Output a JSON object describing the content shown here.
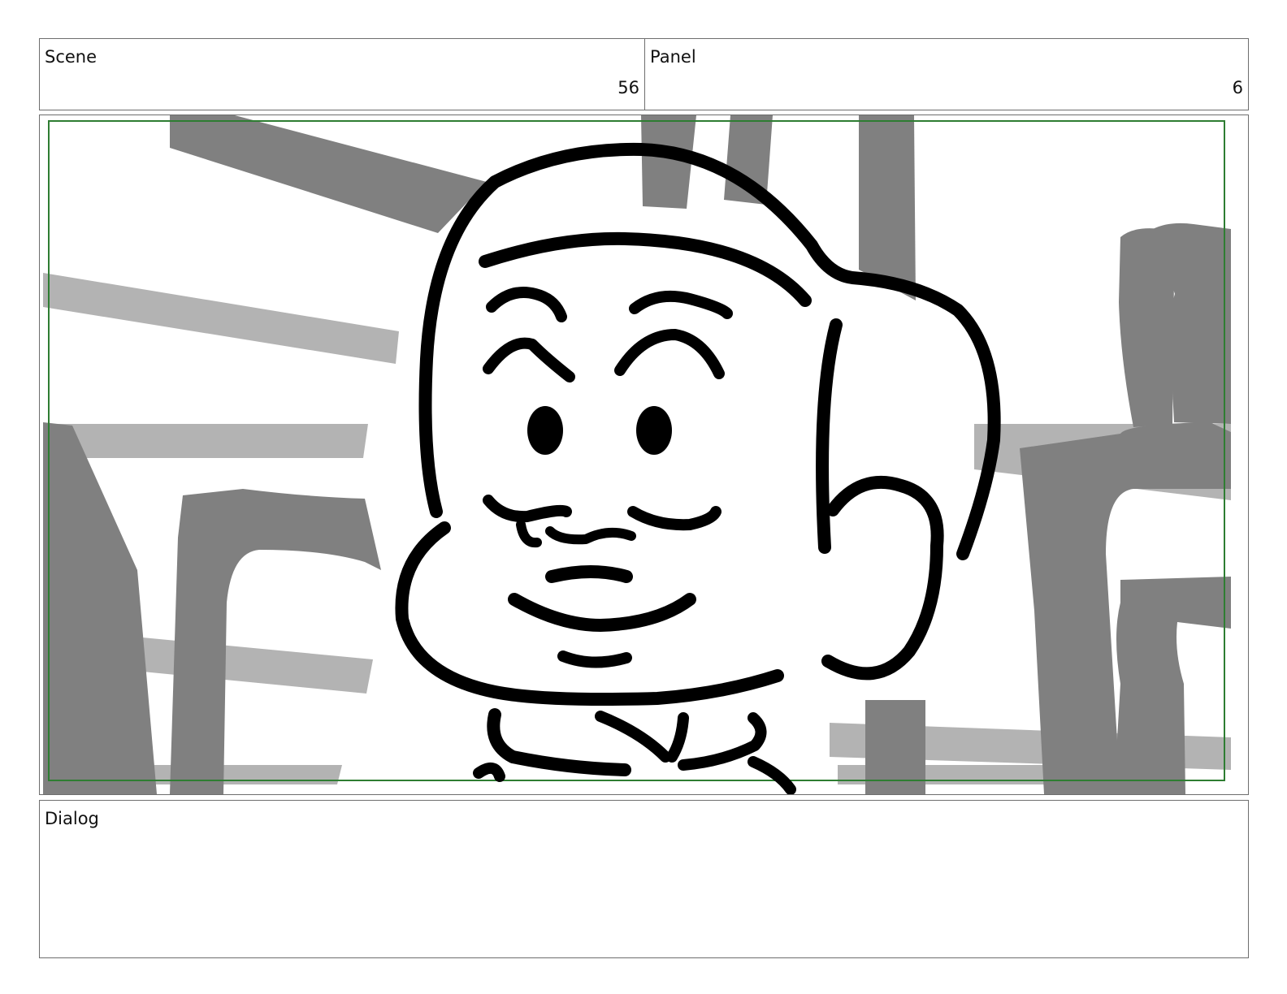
{
  "header": {
    "scene_label": "Scene",
    "scene_value": "56",
    "panel_label": "Panel",
    "panel_value": "6"
  },
  "frame": {
    "safe_area_color": "#2e7d32",
    "background_tone_dark": "#808080",
    "background_tone_light": "#b3b3b3",
    "line_color": "#000000"
  },
  "dialog": {
    "label": "Dialog"
  }
}
